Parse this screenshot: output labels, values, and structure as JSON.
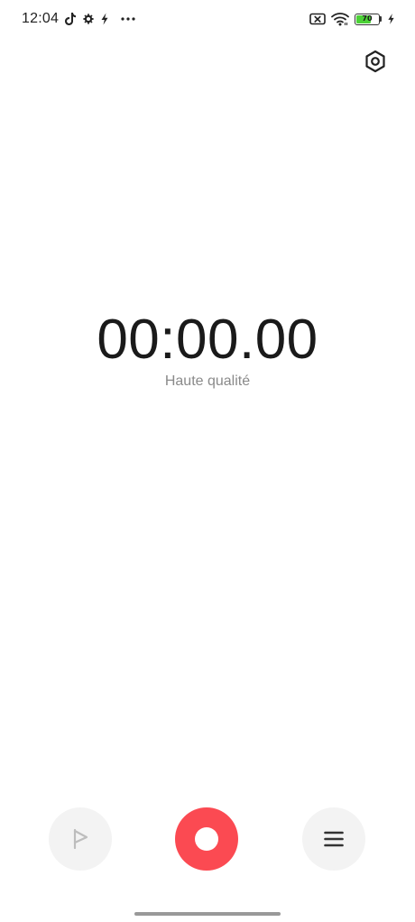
{
  "status_bar": {
    "time": "12:04",
    "left_icons": [
      "tiktok-icon",
      "gear-icon",
      "charging-bolt-icon",
      "more-dots-icon"
    ],
    "right_icons": [
      "no-sim-icon",
      "wifi-icon",
      "battery-icon",
      "charging-bolt-icon"
    ],
    "battery": {
      "level_text": "70",
      "level_fraction": 0.7,
      "fill_color": "#4cd137"
    }
  },
  "header": {
    "settings_icon": "settings-hexagon-icon"
  },
  "recorder": {
    "timer": "00:00.00",
    "quality": "Haute qualité"
  },
  "controls": {
    "flag_icon": "flag-icon",
    "record_icon": "record-icon",
    "record_color": "#fb4a52",
    "list_icon": "list-menu-icon"
  }
}
